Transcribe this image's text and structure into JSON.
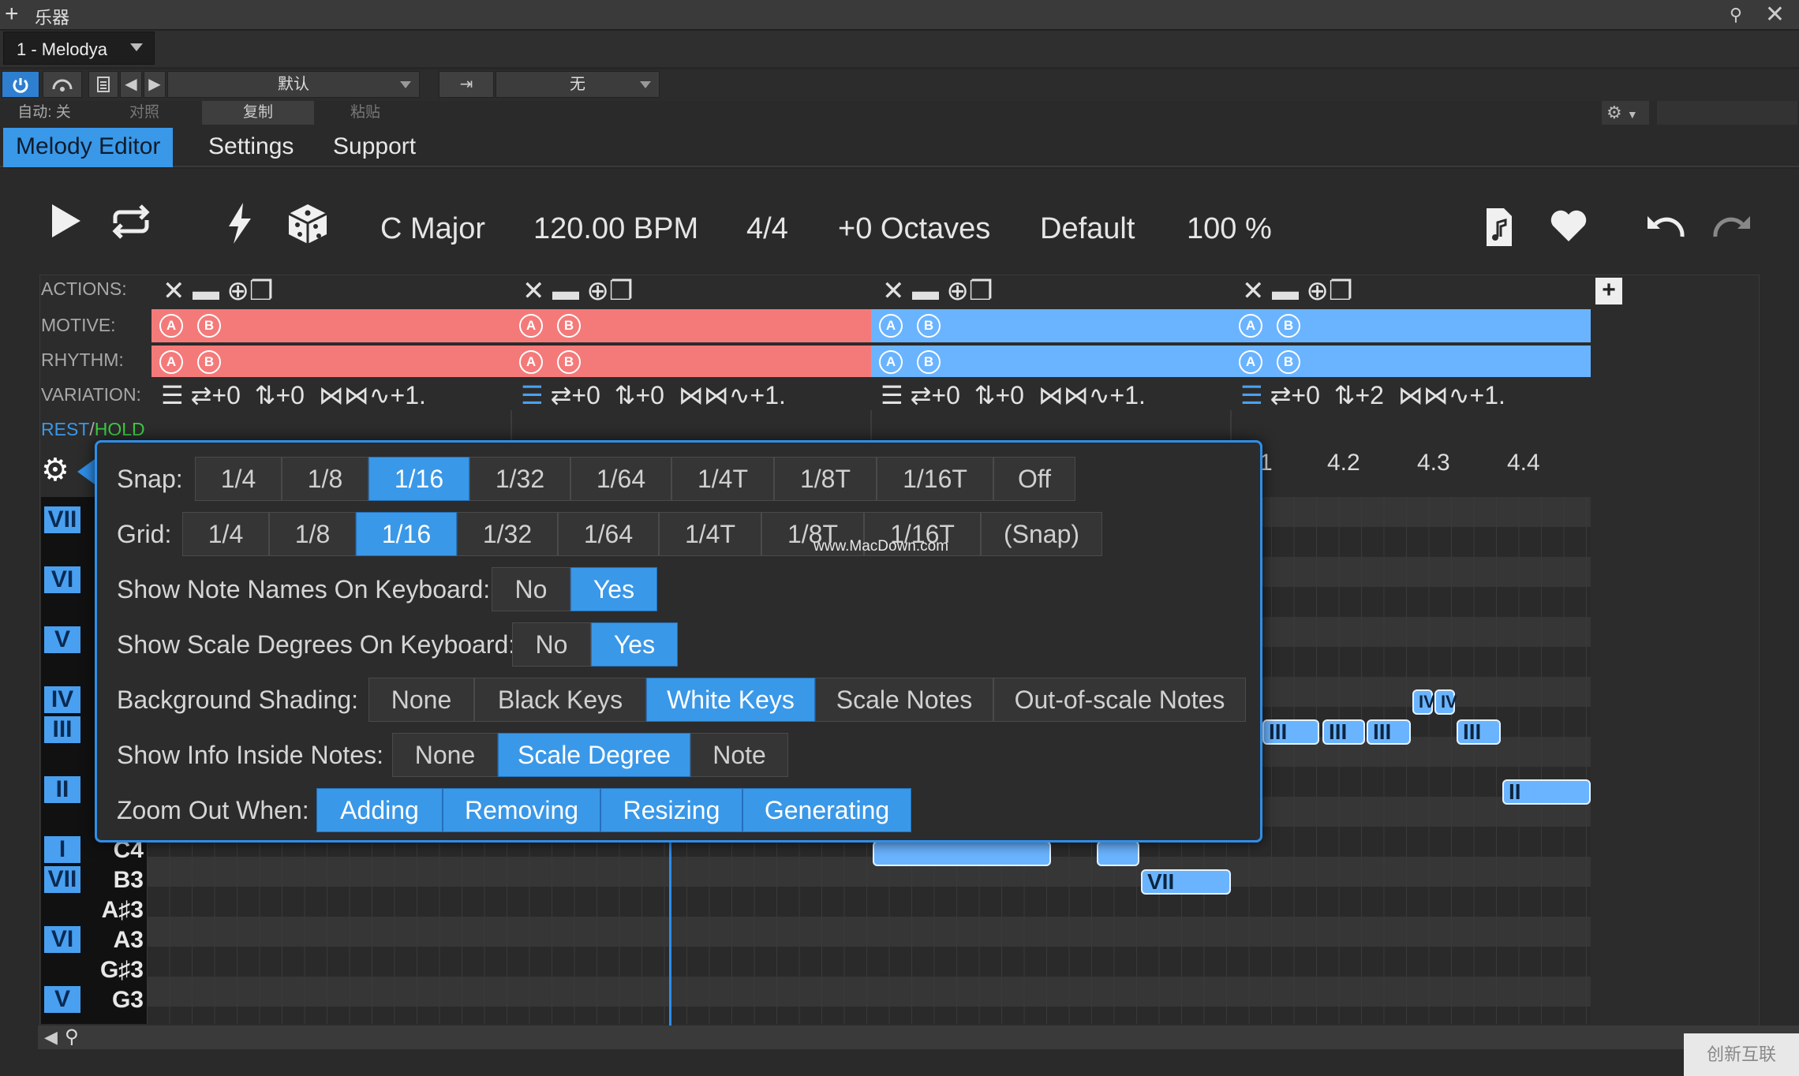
{
  "window": {
    "title": "乐器"
  },
  "track": {
    "name": "1 - Melodya"
  },
  "preset": {
    "name": "默认",
    "output": "无"
  },
  "toolbar": {
    "auto_label": "自动: 关",
    "compare_label": "对照",
    "copy_label": "复制",
    "paste_label": "粘贴"
  },
  "tabs": [
    {
      "label": "Melody Editor"
    },
    {
      "label": "Settings"
    },
    {
      "label": "Support"
    }
  ],
  "transport": {
    "key": "C Major",
    "bpm": "120.00 BPM",
    "time_sig": "4/4",
    "octaves": "+0 Octaves",
    "preset": "Default",
    "zoom": "100 %"
  },
  "rows": {
    "actions": "ACTIONS:",
    "motive": "MOTIVE:",
    "rhythm": "RHYTHM:",
    "variation": "VARIATION:",
    "rest": "REST",
    "slash": "/",
    "hold": "HOLD"
  },
  "ab": {
    "a": "A",
    "b": "B"
  },
  "variations": [
    {
      "a": "+0",
      "b": "+0",
      "c": "+1."
    },
    {
      "a": "+0",
      "b": "+0",
      "c": "+1."
    },
    {
      "a": "+0",
      "b": "+0",
      "c": "+1."
    },
    {
      "a": "+0",
      "b": "+2",
      "c": "+1."
    }
  ],
  "ruler": {
    "m4_1": "1",
    "m4_2": "4.2",
    "m4_3": "4.3",
    "m4_4": "4.4"
  },
  "popup": {
    "snap": {
      "label": "Snap:",
      "options": [
        "1/4",
        "1/8",
        "1/16",
        "1/32",
        "1/64",
        "1/4T",
        "1/8T",
        "1/16T",
        "Off"
      ],
      "selected": "1/16"
    },
    "grid": {
      "label": "Grid:",
      "options": [
        "1/4",
        "1/8",
        "1/16",
        "1/32",
        "1/64",
        "1/4T",
        "1/8T",
        "1/16T",
        "(Snap)"
      ],
      "selected": "1/16"
    },
    "note_names": {
      "label": "Show Note Names On Keyboard:",
      "options": [
        "No",
        "Yes"
      ],
      "selected": "Yes"
    },
    "scale_degrees": {
      "label": "Show Scale Degrees On Keyboard:",
      "options": [
        "No",
        "Yes"
      ],
      "selected": "Yes"
    },
    "shading": {
      "label": "Background Shading:",
      "options": [
        "None",
        "Black Keys",
        "White Keys",
        "Scale Notes",
        "Out-of-scale Notes"
      ],
      "selected": "White Keys"
    },
    "info": {
      "label": "Show Info Inside Notes:",
      "options": [
        "None",
        "Scale Degree",
        "Note"
      ],
      "selected": "Scale Degree"
    },
    "zoom": {
      "label": "Zoom Out When:",
      "options": [
        "Adding",
        "Removing",
        "Resizing",
        "Generating"
      ]
    }
  },
  "watermark_url": "www.MacDown.com",
  "keyboard": [
    {
      "deg": "VII",
      "name": ""
    },
    {
      "deg": "VI",
      "name": ""
    },
    {
      "deg": "V",
      "name": ""
    },
    {
      "deg": "IV",
      "name": ""
    },
    {
      "deg": "III",
      "name": ""
    },
    {
      "deg": "II",
      "name": ""
    },
    {
      "deg": "I",
      "name": "C4"
    },
    {
      "deg": "VII",
      "name": "B3"
    },
    {
      "deg": "",
      "name": "A♯3"
    },
    {
      "deg": "VI",
      "name": "A3"
    },
    {
      "deg": "",
      "name": "G♯3"
    },
    {
      "deg": "V",
      "name": "G3"
    }
  ],
  "notes": {
    "iii": "III",
    "iv": "IV",
    "ii": "II",
    "vii": "VII"
  },
  "corner_logo": "创新互联",
  "colors": {
    "accent": "#3a98e8",
    "motive_red": "#f47a7a",
    "motive_blue": "#6ab4ff"
  }
}
